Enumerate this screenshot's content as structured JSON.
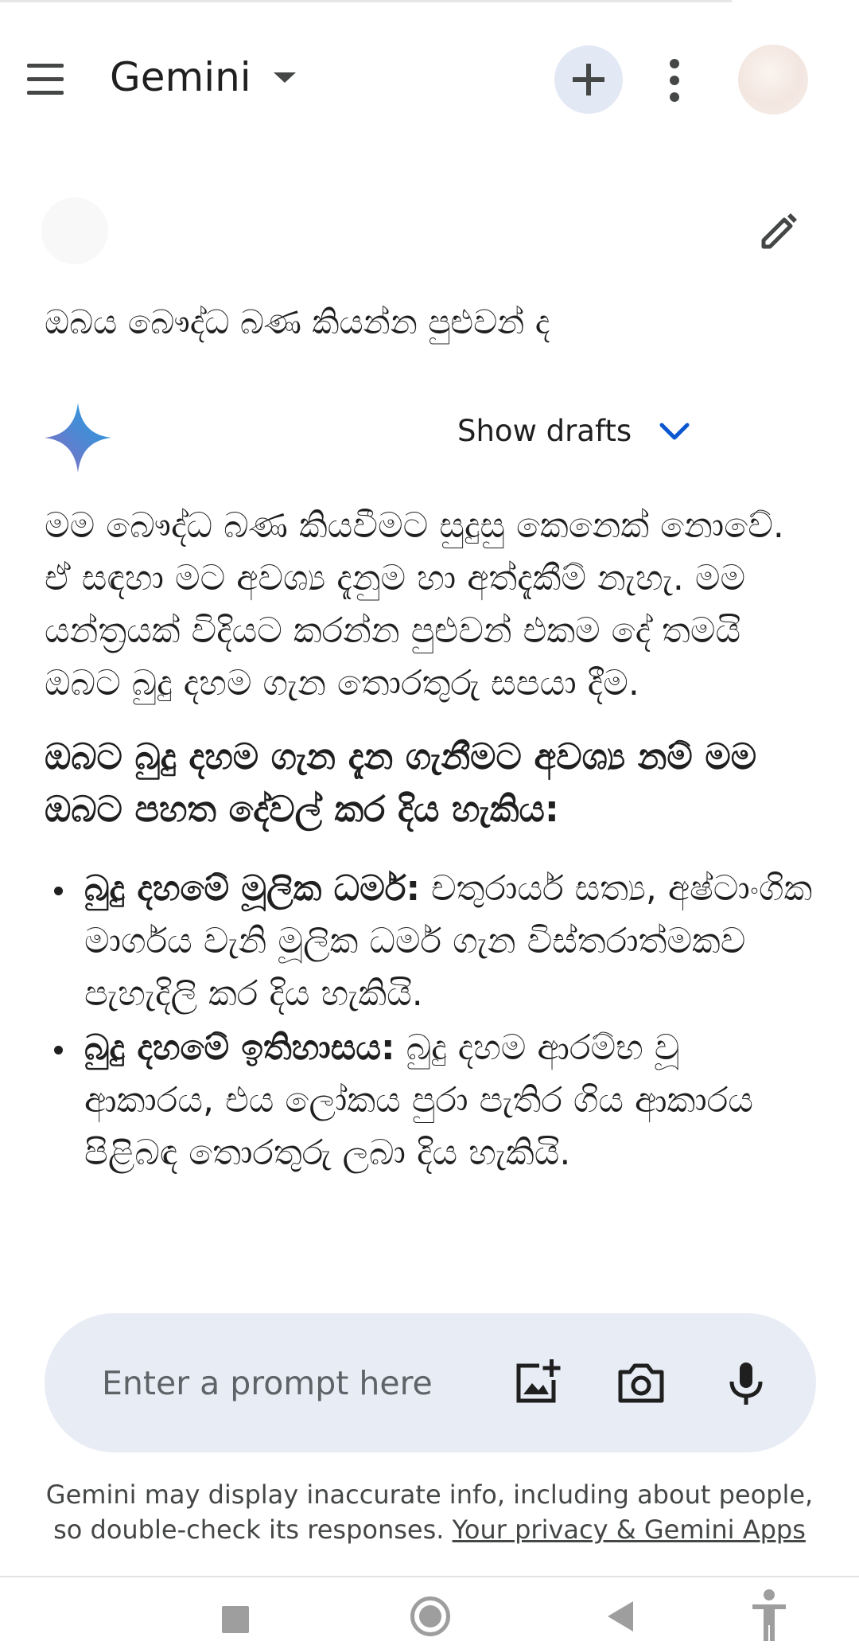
{
  "app": {
    "title": "Gemini",
    "icons": {
      "menu": "menu-icon",
      "dropdown": "caret-down-icon",
      "new_chat": "plus-icon",
      "more": "more-vert-icon",
      "avatar": "account-avatar"
    }
  },
  "conversation": {
    "user_message": "ඔබය බෞද්ධ බණ කියන්න පුළුවන් ද",
    "show_drafts_label": "Show drafts",
    "response": {
      "paragraph": "මම බෞද්ධ බණ කියවීමට සුදුසු කෙනෙක් නොවේ. ඒ සඳහා මට අවශ්‍ය දැනුම හා අත්දැකීම් නැහැ. මම යන්ත්‍රයක් විදියට කරන්න පුළුවන් එකම දේ තමයි ඔබට බුදු දහම ගැන තොරතුරු සපයා දීම.",
      "heading": "ඔබට බුදු දහම ගැන දැන ගැනීමට අවශ්‍ය නම් මම ඔබට පහත දේවල් කර දිය හැකිය:",
      "bullets": [
        {
          "title": "බුදු දහමේ මූලික ධර්ම:",
          "text": " චතුරාර්ය සත්‍ය, අෂ්ටාංගික මාර්ගය වැනි මූලික ධර්ම ගැන විස්තරාත්මකව පැහැදිලි කර දිය හැකියි."
        },
        {
          "title": "බුදු දහමේ ඉතිහාසය:",
          "text": " බුදු දහම ආරම්භ වූ ආකාරය, එය ලෝකය පුරා පැතිර ගිය ආකාරය පිළිබඳ තොරතුරු ලබා දිය හැකියි."
        }
      ]
    }
  },
  "prompt": {
    "placeholder": "Enter a prompt here",
    "icons": [
      "add-image-icon",
      "camera-icon",
      "mic-icon"
    ]
  },
  "disclaimer": {
    "text": "Gemini may display inaccurate info, including about people, so double-check its responses.",
    "link": "Your privacy & Gemini Apps"
  },
  "system_nav": {
    "icons": [
      "recents-icon",
      "home-icon",
      "back-icon",
      "accessibility-icon"
    ]
  }
}
